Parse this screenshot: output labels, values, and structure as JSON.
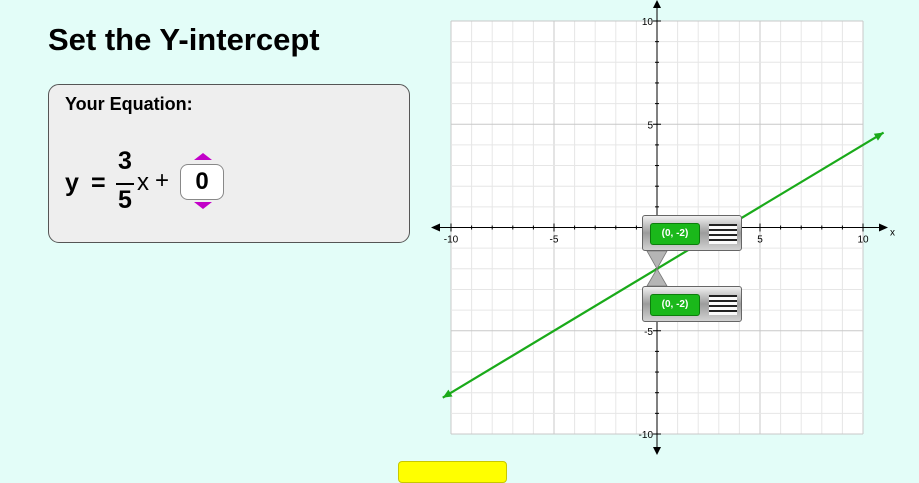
{
  "title": "Set the Y-intercept",
  "equation_panel": {
    "heading": "Your Equation:",
    "y": "y",
    "equals": "=",
    "slope_numerator": "3",
    "slope_denominator": "5",
    "x": "x",
    "plus": "+",
    "intercept_value": "0"
  },
  "graph": {
    "x_min": -10,
    "x_max": 10,
    "y_min": -10,
    "y_max": 10,
    "x_axis_label": "x",
    "x_ticks": [
      "-10",
      "-5",
      "5",
      "10"
    ],
    "y_ticks": [
      "10",
      "5",
      "-5",
      "-10"
    ],
    "line": {
      "slope": 0.6,
      "intercept": -2,
      "x_from": -10.4,
      "x_to": 11.0,
      "color": "#1aaa1a"
    },
    "point_tags": [
      {
        "label": "(0, -2)"
      },
      {
        "label": "(0, -2)"
      }
    ]
  },
  "colors": {
    "background": "#e3fdf8",
    "arrow": "#c200c8",
    "line": "#1aaa1a",
    "tag_green": "#1ab81a",
    "check_button": "#ffff00"
  }
}
